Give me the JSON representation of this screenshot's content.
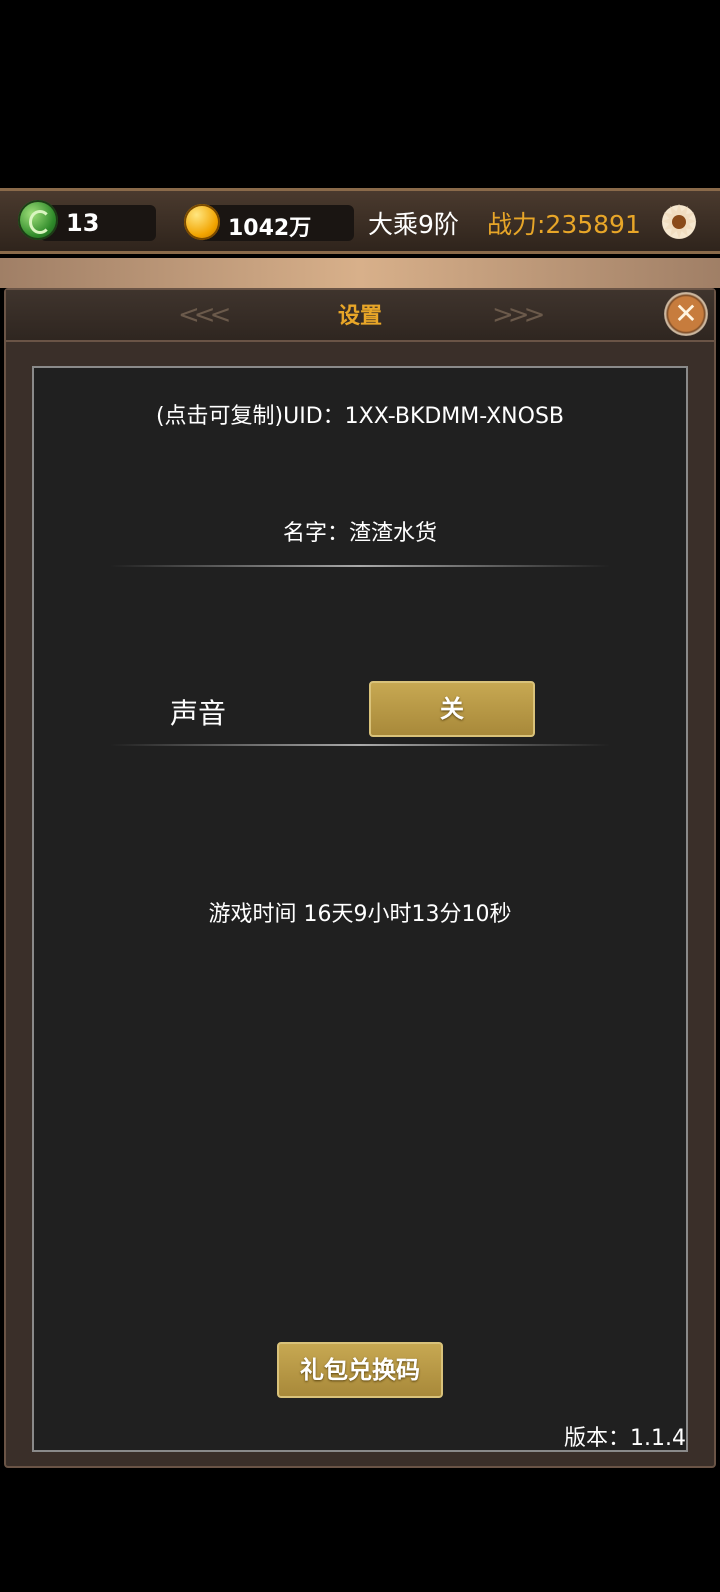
{
  "topbar": {
    "jade_count": "13",
    "gold_amount": "1042万",
    "rank": "大乘9阶",
    "power": "战力:235891"
  },
  "dialog": {
    "title": "设置",
    "uid_text": "(点击可复制)UID：1XX-BKDMM-XNOSB",
    "name_text": "名字：渣渣水货",
    "sound_label": "声音",
    "sound_toggle": "关",
    "playtime": "游戏时间 16天9小时13分10秒",
    "gift_button": "礼包兑换码",
    "version": "版本：1.1.4"
  },
  "colors": {
    "accent_gold": "#e8a628",
    "button_gold": "#b89a45",
    "panel_bg": "#202020"
  }
}
